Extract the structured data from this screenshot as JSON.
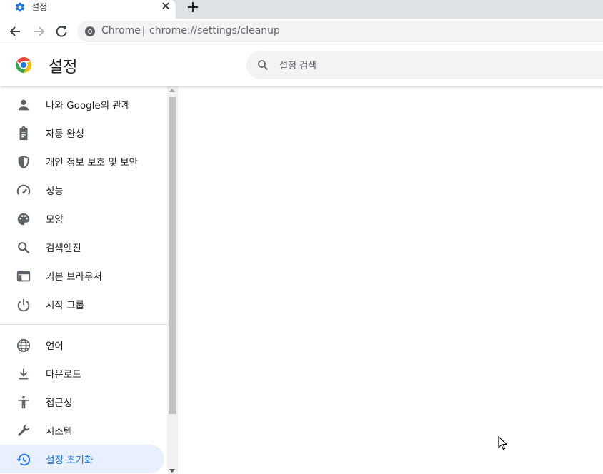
{
  "tab": {
    "title": "설정",
    "close_glyph": "✕"
  },
  "toolbar": {
    "omnibox_chip": "Chrome",
    "url": "chrome://settings/cleanup"
  },
  "header": {
    "title": "설정",
    "search_placeholder": "설정 검색"
  },
  "sidebar": {
    "items": [
      {
        "label": "나와 Google의 관계",
        "icon": "person-icon"
      },
      {
        "label": "자동 완성",
        "icon": "clipboard-icon"
      },
      {
        "label": "개인 정보 보호 및 보안",
        "icon": "shield-icon"
      },
      {
        "label": "성능",
        "icon": "speedometer-icon"
      },
      {
        "label": "모양",
        "icon": "palette-icon"
      },
      {
        "label": "검색엔진",
        "icon": "search-icon"
      },
      {
        "label": "기본 브라우저",
        "icon": "browser-window-icon"
      },
      {
        "label": "시작 그룹",
        "icon": "power-icon"
      },
      {
        "label": "언어",
        "icon": "globe-icon"
      },
      {
        "label": "다운로드",
        "icon": "download-icon"
      },
      {
        "label": "접근성",
        "icon": "accessibility-icon"
      },
      {
        "label": "시스템",
        "icon": "wrench-icon"
      },
      {
        "label": "설정 초기화",
        "icon": "history-icon",
        "active": true
      }
    ]
  },
  "colors": {
    "accent": "#1a73e8",
    "active_bg": "#e8f0fe",
    "icon": "#5f6368"
  }
}
